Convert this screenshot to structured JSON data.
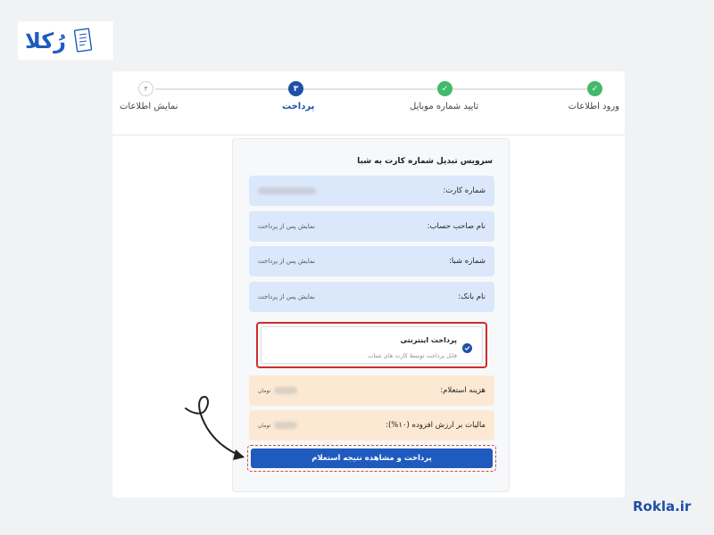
{
  "logo": {
    "text": "رُکلا",
    "icon": "document-icon"
  },
  "stepper": {
    "steps": [
      {
        "label": "ورود اطلاعات",
        "state": "done",
        "marker": "✓"
      },
      {
        "label": "تایید شماره موبایل",
        "state": "done",
        "marker": "✓"
      },
      {
        "label": "پرداخت",
        "state": "active",
        "marker": "۳"
      },
      {
        "label": "نمایش اطلاعات",
        "state": "todo",
        "marker": "۴"
      }
    ]
  },
  "form": {
    "title": "سرویس تبدیل شماره کارت به شبا",
    "fields": [
      {
        "label": "شماره کارت:",
        "value": ""
      },
      {
        "label": "نام صاحب حساب:",
        "value": "نمایش پس از پرداخت"
      },
      {
        "label": "شماره شبا:",
        "value": "نمایش پس از پرداخت"
      },
      {
        "label": "نام بانک:",
        "value": "نمایش پس از پرداخت"
      }
    ],
    "payment_option": {
      "title": "پرداخت اینترنتی",
      "subtitle": "قابل پرداخت توسط کارت های شتاب",
      "selected": true
    },
    "costs": [
      {
        "label": "هزینه استعلام:",
        "unit": "تومان"
      },
      {
        "label": "مالیات بر ارزش افزوده (۱۰%):",
        "unit": "تومان"
      }
    ],
    "submit_label": "پرداخت و مشاهده نتیجه استعلام"
  },
  "brand": "Rokla.ir",
  "colors": {
    "primary": "#1f5bbf",
    "success": "#43b96a",
    "highlight": "#d02c2c"
  }
}
